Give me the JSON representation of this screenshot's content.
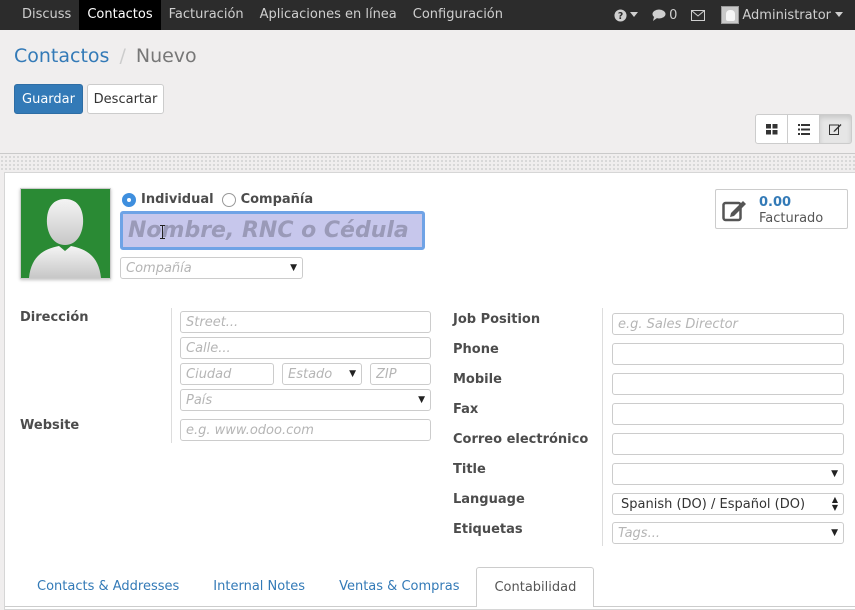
{
  "topbar": {
    "menu": [
      "Discuss",
      "Contactos",
      "Facturación",
      "Aplicaciones en línea",
      "Configuración"
    ],
    "active_index": 1,
    "help_icon": "question-circle-icon",
    "messages_count": "0",
    "mail_icon": "envelope-icon",
    "user_name": "Administrator"
  },
  "breadcrumb": {
    "parent": "Contactos",
    "current": "Nuevo"
  },
  "buttons": {
    "save": "Guardar",
    "discard": "Descartar"
  },
  "views": [
    "kanban-icon",
    "list-icon",
    "form-icon"
  ],
  "form": {
    "type_options": [
      "Individual",
      "Compañía"
    ],
    "type_selected": "Individual",
    "name_placeholder": "Nombre, RNC o Cédula",
    "company_placeholder": "Compañía",
    "stat_value": "0.00",
    "stat_label": "Facturado",
    "address_label": "Dirección",
    "street_placeholder": "Street...",
    "street2_placeholder": "Calle...",
    "city_placeholder": "Ciudad",
    "state_placeholder": "Estado",
    "zip_placeholder": "ZIP",
    "country_placeholder": "País",
    "website_label": "Website",
    "website_placeholder": "e.g. www.odoo.com",
    "job_label": "Job Position",
    "job_placeholder": "e.g. Sales Director",
    "phone_label": "Phone",
    "mobile_label": "Mobile",
    "fax_label": "Fax",
    "email_label": "Correo electrónico",
    "title_label": "Title",
    "language_label": "Language",
    "language_value": "Spanish (DO) / Español (DO)",
    "tags_label": "Etiquetas",
    "tags_placeholder": "Tags..."
  },
  "tabs": [
    "Contacts & Addresses",
    "Internal Notes",
    "Ventas & Compras",
    "Contabilidad"
  ],
  "active_tab": 3,
  "colors": {
    "primary": "#337ab7",
    "topbar": "#2c2c2c",
    "photo_bg": "#2a8a34"
  }
}
